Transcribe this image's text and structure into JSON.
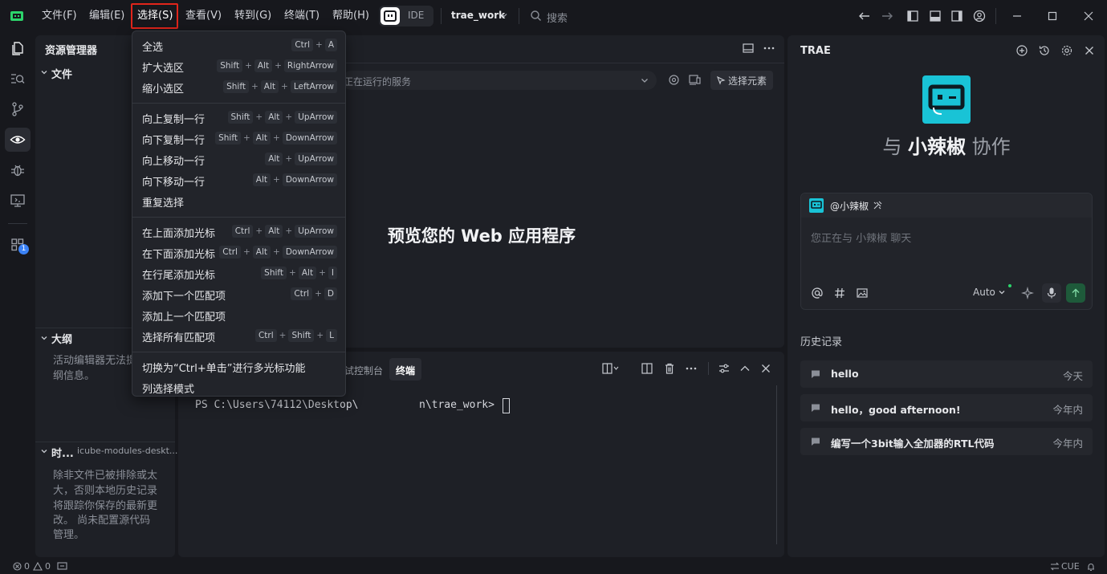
{
  "menubar": {
    "items": [
      "文件(F)",
      "编辑(E)",
      "选择(S)",
      "查看(V)",
      "转到(G)",
      "终端(T)",
      "帮助(H)"
    ],
    "ide_label": "IDE",
    "workspace": "trae_work",
    "search_placeholder": "搜索"
  },
  "explorer": {
    "title": "资源管理器",
    "files_section": "文件",
    "outline_section": "大纲",
    "outline_text_1": "活动编辑器无法提",
    "outline_text_2": "纲信息。",
    "timeline_section": "时...",
    "timeline_source": "icube-modules-deskt...",
    "timeline_text": [
      "除非文件已被排除或太",
      "大，否则本地历史记录",
      "将跟踪你保存的最新更",
      "改。 尚未配置源代码",
      "管理。"
    ]
  },
  "preview": {
    "url_placeholder": "正在运行的服务",
    "select_element": "选择元素",
    "title": "预览您的 Web 应用程序"
  },
  "terminal": {
    "tabs": [
      "试控制台",
      "终端"
    ],
    "prompt_left": "PS C:\\Users\\74112\\Desktop\\",
    "prompt_right": "n\\trae_work> "
  },
  "select_menu": {
    "groups": [
      [
        {
          "label": "全选",
          "keys": [
            "Ctrl",
            "A"
          ]
        },
        {
          "label": "扩大选区",
          "keys": [
            "Shift",
            "Alt",
            "RightArrow"
          ]
        },
        {
          "label": "缩小选区",
          "keys": [
            "Shift",
            "Alt",
            "LeftArrow"
          ]
        }
      ],
      [
        {
          "label": "向上复制一行",
          "keys": [
            "Shift",
            "Alt",
            "UpArrow"
          ]
        },
        {
          "label": "向下复制一行",
          "keys": [
            "Shift",
            "Alt",
            "DownArrow"
          ]
        },
        {
          "label": "向上移动一行",
          "keys": [
            "Alt",
            "UpArrow"
          ]
        },
        {
          "label": "向下移动一行",
          "keys": [
            "Alt",
            "DownArrow"
          ]
        },
        {
          "label": "重复选择",
          "keys": []
        }
      ],
      [
        {
          "label": "在上面添加光标",
          "keys": [
            "Ctrl",
            "Alt",
            "UpArrow"
          ]
        },
        {
          "label": "在下面添加光标",
          "keys": [
            "Ctrl",
            "Alt",
            "DownArrow"
          ]
        },
        {
          "label": "在行尾添加光标",
          "keys": [
            "Shift",
            "Alt",
            "I"
          ]
        },
        {
          "label": "添加下一个匹配项",
          "keys": [
            "Ctrl",
            "D"
          ]
        },
        {
          "label": "添加上一个匹配项",
          "keys": []
        },
        {
          "label": "选择所有匹配项",
          "keys": [
            "Ctrl",
            "Shift",
            "L"
          ]
        }
      ],
      [
        {
          "label": "切换为“Ctrl+单击”进行多光标功能",
          "keys": []
        },
        {
          "label": "列选择模式",
          "keys": []
        }
      ]
    ]
  },
  "chat": {
    "title": "TRAE",
    "collab_prefix": "与 ",
    "collab_name": "小辣椒",
    "collab_suffix": " 协作",
    "agent_tag": "@小辣椒",
    "placeholder": "您正在与 小辣椒 聊天",
    "mode": "Auto",
    "history_title": "历史记录",
    "history": [
      {
        "title": "hello",
        "date": "今天"
      },
      {
        "title": "hello，good afternoon!",
        "date": "今年内"
      },
      {
        "title": "编写一个3bit输入全加器的RTL代码",
        "date": "今年内"
      }
    ]
  },
  "statusbar": {
    "errors": "0",
    "warnings": "0",
    "right_label": "CUE"
  },
  "activity": {
    "badge": "1"
  },
  "colors": {
    "accent_red": "#e1251b",
    "bot_cyan": "#19c3d6",
    "send_green": "#1e5a3a"
  }
}
